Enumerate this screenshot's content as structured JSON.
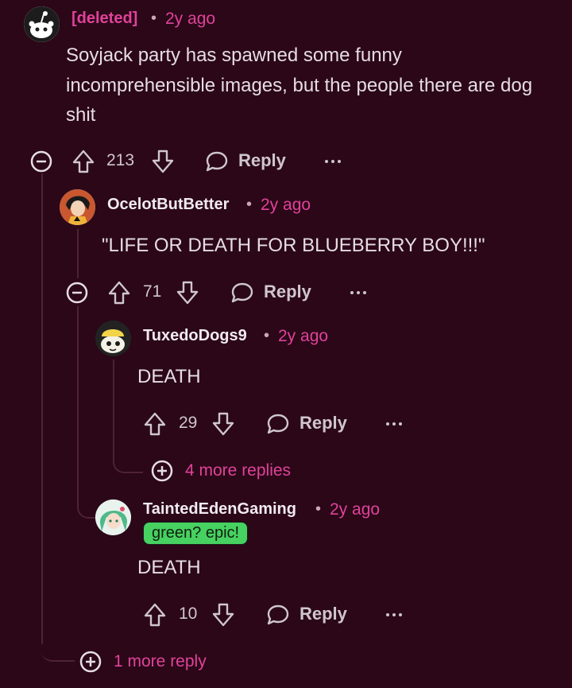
{
  "comments": [
    {
      "username": "[deleted]",
      "time": "2y ago",
      "body": "Soyjack party has spawned some funny incomprehensible images, but the people there are dog shit",
      "votes": "213",
      "reply_label": "Reply",
      "more_icon": "ellipsis-icon",
      "avatar_icon": "reddit-snoo-icon"
    },
    {
      "username": "OcelotButBetter",
      "time": "2y ago",
      "body": "\"LIFE OR DEATH FOR BLUEBERRY BOY!!!\"",
      "votes": "71",
      "reply_label": "Reply",
      "avatar_icon": "anime-character-avatar"
    },
    {
      "username": "TuxedoDogs9",
      "time": "2y ago",
      "body": "DEATH",
      "votes": "29",
      "reply_label": "Reply",
      "avatar_icon": "snoo-hat-avatar"
    },
    {
      "username": "TaintedEdenGaming",
      "time": "2y ago",
      "flair": "green? epic!",
      "body": "DEATH",
      "votes": "10",
      "reply_label": "Reply",
      "avatar_icon": "green-hair-avatar"
    }
  ],
  "more_replies": {
    "level3": "4 more replies",
    "level2": "1 more reply"
  },
  "colors": {
    "background": "#2b0718",
    "accent": "#e0429a",
    "flair": "#46d160",
    "thread_line": "#4e2137"
  },
  "dot": "•"
}
